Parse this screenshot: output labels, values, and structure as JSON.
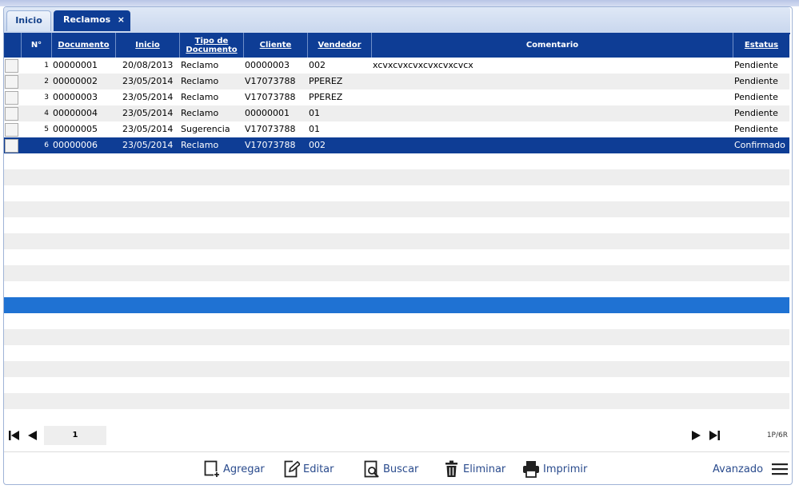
{
  "tabs": [
    {
      "label": "Inicio"
    },
    {
      "label": "Reclamos",
      "close": "×"
    }
  ],
  "grid": {
    "columns": [
      "N°",
      "Documento",
      "Inicio",
      "Tipo de Documento",
      "Cliente",
      "Vendedor",
      "Comentario",
      "Estatus"
    ],
    "rows": [
      {
        "n": "1",
        "documento": "00000001",
        "inicio": "20/08/2013",
        "tipo": "Reclamo",
        "cliente": "00000003",
        "vendedor": "002",
        "comentario": "xcvxcvxcvxcvxcvxcvcx",
        "estatus": "Pendiente"
      },
      {
        "n": "2",
        "documento": "00000002",
        "inicio": "23/05/2014",
        "tipo": "Reclamo",
        "cliente": "V17073788",
        "vendedor": "PPEREZ",
        "comentario": "",
        "estatus": "Pendiente"
      },
      {
        "n": "3",
        "documento": "00000003",
        "inicio": "23/05/2014",
        "tipo": "Reclamo",
        "cliente": "V17073788",
        "vendedor": "PPEREZ",
        "comentario": "",
        "estatus": "Pendiente"
      },
      {
        "n": "4",
        "documento": "00000004",
        "inicio": "23/05/2014",
        "tipo": "Reclamo",
        "cliente": "00000001",
        "vendedor": "01",
        "comentario": "",
        "estatus": "Pendiente"
      },
      {
        "n": "5",
        "documento": "00000005",
        "inicio": "23/05/2014",
        "tipo": "Sugerencia",
        "cliente": "V17073788",
        "vendedor": "01",
        "comentario": "",
        "estatus": "Pendiente"
      },
      {
        "n": "6",
        "documento": "00000006",
        "inicio": "23/05/2014",
        "tipo": "Reclamo",
        "cliente": "V17073788",
        "vendedor": "002",
        "comentario": "",
        "estatus": "Confirmado"
      }
    ],
    "selected_row": 6
  },
  "pager": {
    "page": "1",
    "info": "1P/6R",
    "icons": [
      "first-page-icon",
      "prev-page-icon",
      "next-page-icon",
      "last-page-icon"
    ]
  },
  "toolbar": {
    "agregar": "Agregar",
    "editar": "Editar",
    "buscar": "Buscar",
    "eliminar": "Eliminar",
    "imprimir": "Imprimir",
    "avanzado": "Avanzado"
  },
  "colors": {
    "header": "#0e3d95",
    "selected": "#0e3d95",
    "highlight": "#1f72d3",
    "stripe": "#eeeeee"
  }
}
